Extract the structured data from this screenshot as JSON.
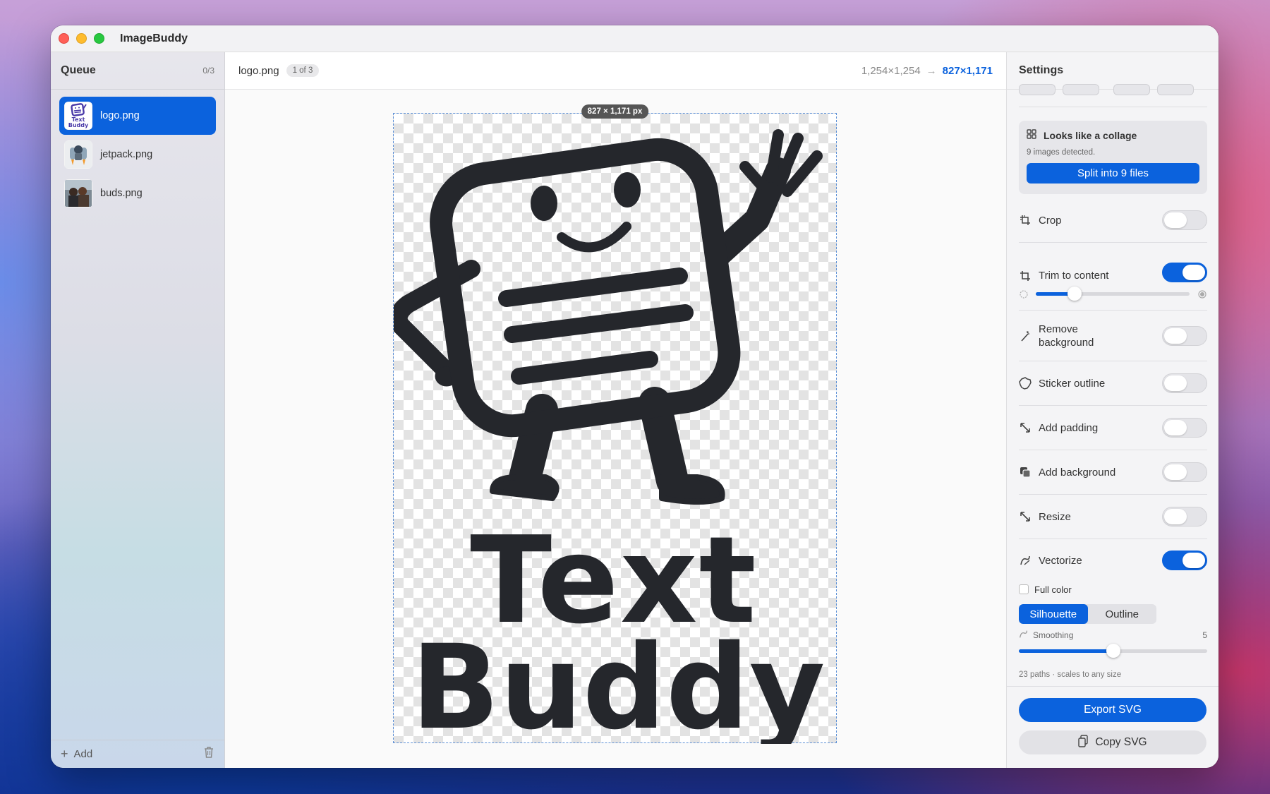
{
  "window": {
    "title": "ImageBuddy"
  },
  "sidebar": {
    "title": "Queue",
    "count": "0/3",
    "items": [
      {
        "name": "logo.png",
        "active": true,
        "thumb_icon": "text-buddy-thumb-icon"
      },
      {
        "name": "jetpack.png",
        "active": false,
        "thumb_icon": "jetpack-thumb-icon"
      },
      {
        "name": "buds.png",
        "active": false,
        "thumb_icon": "photo-thumb-icon"
      }
    ],
    "add_label": "Add",
    "trash_icon": "trash-icon"
  },
  "main": {
    "file_name": "logo.png",
    "file_position": "1 of 3",
    "original_size": "1,254×1,254",
    "arrow": "→",
    "new_size": "827×1,171",
    "canvas_size_label": "827 × 1,171 px",
    "artwork_text": [
      "Text",
      "Buddy"
    ]
  },
  "settings": {
    "title": "Settings",
    "collage": {
      "title": "Looks like a collage",
      "subtitle": "9 images detected.",
      "button": "Split into 9 files"
    },
    "options": {
      "crop": {
        "label": "Crop",
        "on": false
      },
      "trim": {
        "label": "Trim to content",
        "on": true,
        "slider_value": 0.25
      },
      "remove_bg": {
        "label": "Remove background",
        "on": false
      },
      "sticker": {
        "label": "Sticker outline",
        "on": false
      },
      "padding": {
        "label": "Add padding",
        "on": false
      },
      "add_bg": {
        "label": "Add background",
        "on": false
      },
      "resize": {
        "label": "Resize",
        "on": false
      },
      "vectorize": {
        "label": "Vectorize",
        "on": true
      }
    },
    "vectorize": {
      "full_color_label": "Full color",
      "full_color_checked": false,
      "modes": [
        "Silhouette",
        "Outline"
      ],
      "active_mode": "Silhouette",
      "smoothing_label": "Smoothing",
      "smoothing_value": "5",
      "smoothing_fraction": 0.5,
      "paths_note": "23 paths · scales to any size"
    },
    "export_label": "Export SVG",
    "copy_label": "Copy SVG"
  },
  "colors": {
    "accent": "#0b62dd",
    "ink": "#25272c"
  }
}
